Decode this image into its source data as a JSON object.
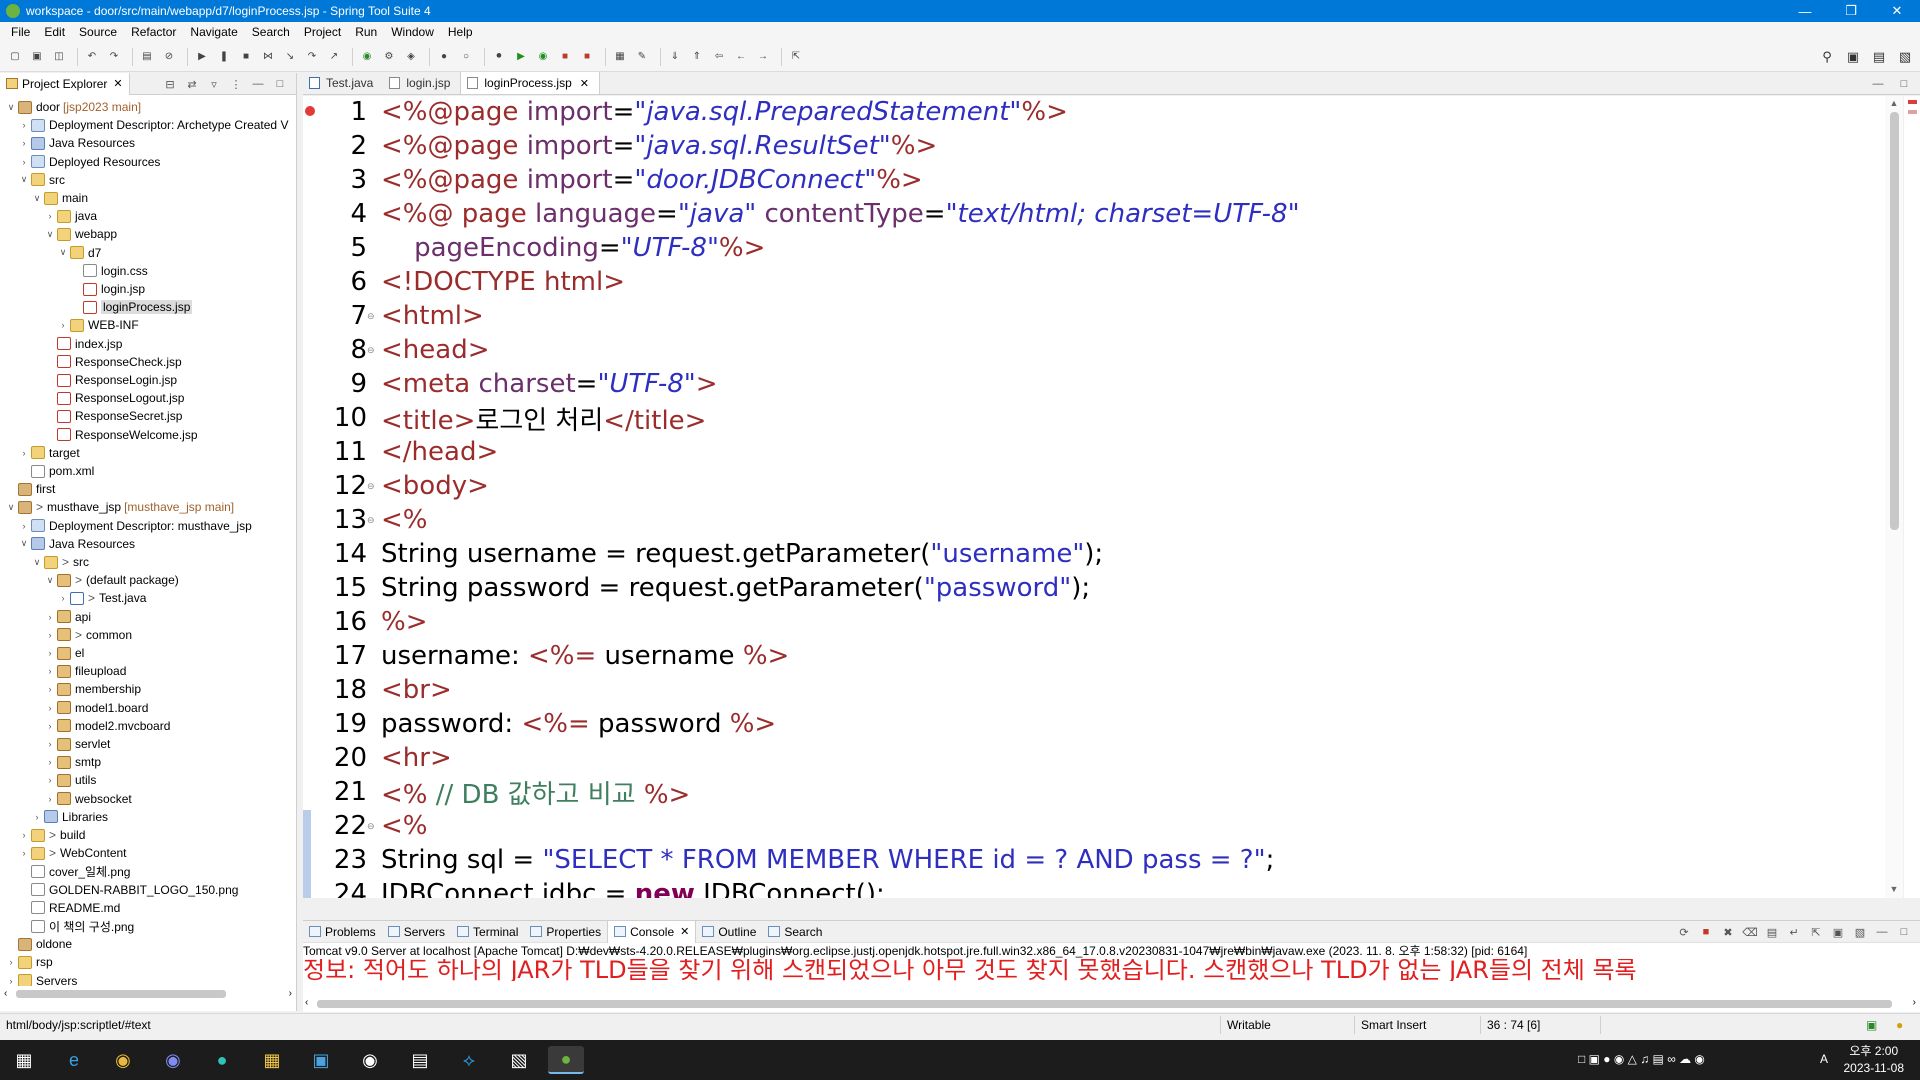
{
  "window": {
    "title": "workspace - door/src/main/webapp/d7/loginProcess.jsp - Spring Tool Suite 4"
  },
  "menu": [
    "File",
    "Edit",
    "Source",
    "Refactor",
    "Navigate",
    "Search",
    "Project",
    "Run",
    "Window",
    "Help"
  ],
  "project_explorer": {
    "tab_label": "Project Explorer",
    "tree": [
      {
        "label": "door",
        "extra": "[jsp2023 main]",
        "icon": "project-icon",
        "chev": "v"
      },
      {
        "label": "Deployment Descriptor: Archetype Created V",
        "icon": "deployment-descriptor-icon",
        "chev": ">"
      },
      {
        "label": "Java Resources",
        "icon": "java-resources-icon",
        "chev": ">"
      },
      {
        "label": "Deployed Resources",
        "icon": "deployed-resources-icon",
        "chev": ">"
      },
      {
        "label": "src",
        "icon": "folder-icon",
        "chev": "v"
      },
      {
        "label": "main",
        "icon": "folder-icon",
        "chev": "v"
      },
      {
        "label": "java",
        "icon": "folder-icon",
        "chev": ">"
      },
      {
        "label": "webapp",
        "icon": "folder-icon",
        "chev": "v"
      },
      {
        "label": "d7",
        "icon": "folder-icon",
        "chev": "v"
      },
      {
        "label": "login.css",
        "icon": "file-icon",
        "chev": ""
      },
      {
        "label": "login.jsp",
        "icon": "jsp-file-icon",
        "chev": ""
      },
      {
        "label": "loginProcess.jsp",
        "icon": "jsp-file-icon",
        "chev": "",
        "selected": true
      },
      {
        "label": "WEB-INF",
        "icon": "folder-icon",
        "chev": ">"
      },
      {
        "label": "index.jsp",
        "icon": "jsp-file-icon",
        "chev": ""
      },
      {
        "label": "ResponseCheck.jsp",
        "icon": "jsp-file-icon",
        "chev": ""
      },
      {
        "label": "ResponseLogin.jsp",
        "icon": "jsp-file-icon",
        "chev": ""
      },
      {
        "label": "ResponseLogout.jsp",
        "icon": "jsp-file-icon",
        "chev": ""
      },
      {
        "label": "ResponseSecret.jsp",
        "icon": "jsp-file-icon",
        "chev": ""
      },
      {
        "label": "ResponseWelcome.jsp",
        "icon": "jsp-file-icon",
        "chev": ""
      },
      {
        "label": "target",
        "icon": "folder-icon",
        "chev": ">"
      },
      {
        "label": "pom.xml",
        "icon": "xml-file-icon",
        "chev": ""
      },
      {
        "label": "first",
        "icon": "project-icon",
        "chev": ""
      },
      {
        "label": "musthave_jsp",
        "prefix": ">",
        "extra": "[musthave_jsp main]",
        "icon": "project-icon",
        "chev": "v"
      },
      {
        "label": "Deployment Descriptor: musthave_jsp",
        "icon": "deployment-descriptor-icon",
        "chev": ">"
      },
      {
        "label": "Java Resources",
        "icon": "java-resources-icon",
        "chev": "v"
      },
      {
        "label": "src",
        "prefix": ">",
        "icon": "source-folder-icon",
        "chev": "v"
      },
      {
        "label": "(default package)",
        "prefix": ">",
        "icon": "package-icon",
        "chev": "v"
      },
      {
        "label": "Test.java",
        "prefix": ">",
        "icon": "java-file-icon",
        "chev": ">"
      },
      {
        "label": "api",
        "icon": "package-icon",
        "chev": ">"
      },
      {
        "label": "common",
        "prefix": ">",
        "icon": "package-icon",
        "chev": ">"
      },
      {
        "label": "el",
        "icon": "package-icon",
        "chev": ">"
      },
      {
        "label": "fileupload",
        "icon": "package-icon",
        "chev": ">"
      },
      {
        "label": "membership",
        "icon": "package-icon",
        "chev": ">"
      },
      {
        "label": "model1.board",
        "icon": "package-icon",
        "chev": ">"
      },
      {
        "label": "model2.mvcboard",
        "icon": "package-icon",
        "chev": ">"
      },
      {
        "label": "servlet",
        "icon": "package-icon",
        "chev": ">"
      },
      {
        "label": "smtp",
        "icon": "package-icon",
        "chev": ">"
      },
      {
        "label": "utils",
        "icon": "package-icon",
        "chev": ">"
      },
      {
        "label": "websocket",
        "icon": "package-icon",
        "chev": ">"
      },
      {
        "label": "Libraries",
        "icon": "libraries-icon",
        "chev": ">"
      },
      {
        "label": "build",
        "prefix": ">",
        "icon": "folder-icon",
        "chev": ">"
      },
      {
        "label": "WebContent",
        "prefix": ">",
        "icon": "folder-icon",
        "chev": ">"
      },
      {
        "label": "cover_일체.png",
        "icon": "image-file-icon",
        "chev": ""
      },
      {
        "label": "GOLDEN-RABBIT_LOGO_150.png",
        "icon": "image-file-icon",
        "chev": ""
      },
      {
        "label": "README.md",
        "icon": "file-icon",
        "chev": ""
      },
      {
        "label": "이 책의 구성.png",
        "icon": "image-file-icon",
        "chev": ""
      },
      {
        "label": "oldone",
        "icon": "project-icon",
        "chev": ""
      },
      {
        "label": "rsp",
        "icon": "folder-icon",
        "chev": ">"
      },
      {
        "label": "Servers",
        "icon": "folder-icon",
        "chev": ">"
      }
    ]
  },
  "editor": {
    "tabs": [
      {
        "label": "Test.java",
        "active": false
      },
      {
        "label": "login.jsp",
        "active": false
      },
      {
        "label": "loginProcess.jsp",
        "active": true
      }
    ],
    "lines": [
      {
        "n": "1",
        "tokens": [
          [
            "tag",
            "<%@page "
          ],
          [
            "attr",
            "import"
          ],
          [
            "plain",
            "="
          ],
          [
            "str",
            "\"java.sql.PreparedStatement\""
          ],
          [
            "tag",
            "%>"
          ]
        ]
      },
      {
        "n": "2",
        "tokens": [
          [
            "tag",
            "<%@page "
          ],
          [
            "attr",
            "import"
          ],
          [
            "plain",
            "="
          ],
          [
            "str",
            "\"java.sql.ResultSet\""
          ],
          [
            "tag",
            "%>"
          ]
        ]
      },
      {
        "n": "3",
        "tokens": [
          [
            "tag",
            "<%@page "
          ],
          [
            "attr",
            "import"
          ],
          [
            "plain",
            "="
          ],
          [
            "str",
            "\"door.JDBConnect\""
          ],
          [
            "tag",
            "%>"
          ]
        ]
      },
      {
        "n": "4",
        "tokens": [
          [
            "tag",
            "<%@ page "
          ],
          [
            "attr",
            "language"
          ],
          [
            "plain",
            "="
          ],
          [
            "str",
            "\"java\""
          ],
          [
            "plain",
            " "
          ],
          [
            "attr",
            "contentType"
          ],
          [
            "plain",
            "="
          ],
          [
            "str",
            "\"text/html; charset=UTF-8\""
          ]
        ]
      },
      {
        "n": "5",
        "tokens": [
          [
            "plain",
            "    "
          ],
          [
            "attr",
            "pageEncoding"
          ],
          [
            "plain",
            "="
          ],
          [
            "str",
            "\"UTF-8\""
          ],
          [
            "tag",
            "%>"
          ]
        ]
      },
      {
        "n": "6",
        "tokens": [
          [
            "tagname",
            "<!DOCTYPE html>"
          ]
        ]
      },
      {
        "n": "7",
        "fold": true,
        "tokens": [
          [
            "tagname",
            "<html>"
          ]
        ]
      },
      {
        "n": "8",
        "fold": true,
        "tokens": [
          [
            "tagname",
            "<head>"
          ]
        ]
      },
      {
        "n": "9",
        "tokens": [
          [
            "tagname",
            "<meta "
          ],
          [
            "attr",
            "charset"
          ],
          [
            "plain",
            "="
          ],
          [
            "str",
            "\"UTF-8\""
          ],
          [
            "tagname",
            ">"
          ]
        ]
      },
      {
        "n": "10",
        "tokens": [
          [
            "tagname",
            "<title>"
          ],
          [
            "plain",
            "로그인 처리"
          ],
          [
            "tagname",
            "</title>"
          ]
        ]
      },
      {
        "n": "11",
        "tokens": [
          [
            "tagname",
            "</head>"
          ]
        ]
      },
      {
        "n": "12",
        "fold": true,
        "tokens": [
          [
            "tagname",
            "<body>"
          ]
        ]
      },
      {
        "n": "13",
        "fold": true,
        "tokens": [
          [
            "tag",
            "<%"
          ]
        ]
      },
      {
        "n": "14",
        "tokens": [
          [
            "plain",
            "String username = request.getParameter("
          ],
          [
            "jstr",
            "\"username\""
          ],
          [
            "plain",
            ");"
          ]
        ]
      },
      {
        "n": "15",
        "tokens": [
          [
            "plain",
            "String password = request.getParameter("
          ],
          [
            "jstr",
            "\"password\""
          ],
          [
            "plain",
            ");"
          ]
        ]
      },
      {
        "n": "16",
        "tokens": [
          [
            "tag",
            "%>"
          ]
        ]
      },
      {
        "n": "17",
        "tokens": [
          [
            "plain",
            "username: "
          ],
          [
            "tag",
            "<%="
          ],
          [
            "plain",
            " username "
          ],
          [
            "tag",
            "%>"
          ]
        ]
      },
      {
        "n": "18",
        "tokens": [
          [
            "tagname",
            "<br>"
          ]
        ]
      },
      {
        "n": "19",
        "tokens": [
          [
            "plain",
            "password: "
          ],
          [
            "tag",
            "<%="
          ],
          [
            "plain",
            " password "
          ],
          [
            "tag",
            "%>"
          ]
        ]
      },
      {
        "n": "20",
        "tokens": [
          [
            "tagname",
            "<hr>"
          ]
        ]
      },
      {
        "n": "21",
        "tokens": [
          [
            "tag",
            "<%"
          ],
          [
            "cmt",
            " // DB 값하고 비교 "
          ],
          [
            "tag",
            "%>"
          ]
        ]
      },
      {
        "n": "22",
        "fold": true,
        "tokens": [
          [
            "tag",
            "<%"
          ]
        ]
      },
      {
        "n": "23",
        "tokens": [
          [
            "plain",
            "String sql = "
          ],
          [
            "jstr",
            "\"SELECT * FROM MEMBER WHERE id = ? AND pass = ?\""
          ],
          [
            "plain",
            ";"
          ]
        ]
      },
      {
        "n": "24",
        "tokens": [
          [
            "plain",
            "JDBConnect jdbc = "
          ],
          [
            "kw",
            "new"
          ],
          [
            "plain",
            " JDBConnect();"
          ]
        ]
      }
    ]
  },
  "bottom_panel": {
    "tabs": [
      {
        "label": "Problems",
        "active": false
      },
      {
        "label": "Servers",
        "active": false
      },
      {
        "label": "Terminal",
        "active": false
      },
      {
        "label": "Properties",
        "active": false
      },
      {
        "label": "Console",
        "active": true
      },
      {
        "label": "Outline",
        "active": false
      },
      {
        "label": "Search",
        "active": false
      }
    ],
    "console_title": "Tomcat v9.0 Server at localhost [Apache Tomcat] D:₩dev₩sts-4.20.0.RELEASE₩plugins₩org.eclipse.justj.openjdk.hotspot.jre.full.win32.x86_64_17.0.8.v20230831-1047₩jre₩bin₩javaw.exe  (2023. 11. 8. 오후 1:58:32) [pid: 6164]",
    "console_line": "정보: 적어도 하나의 JAR가 TLD들을 찾기 위해 스캔되었으나 아무 것도 찾지 못했습니다. 스캔했으나 TLD가 없는 JAR들의 전체 목록"
  },
  "statusbar": {
    "path": "html/body/jsp:scriptlet/#text",
    "writable": "Writable",
    "insert_mode": "Smart Insert",
    "position": "36 : 74 [6]"
  },
  "taskbar": {
    "time": "오후 2:00",
    "date": "2023-11-08",
    "ime": "A"
  },
  "colors": {
    "titlebar": "#0078d7",
    "jsp_tag": "#9a2c2c",
    "attribute": "#6b2f6b",
    "string": "#2e2ec0",
    "console_error": "#e02020"
  }
}
